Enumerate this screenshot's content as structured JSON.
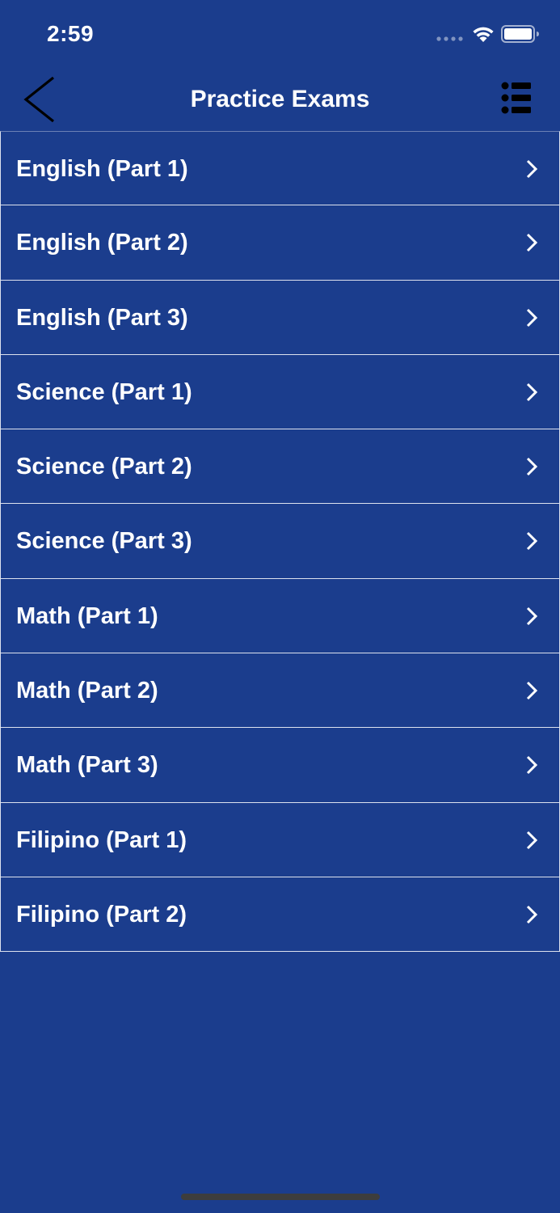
{
  "status_bar": {
    "time": "2:59"
  },
  "nav": {
    "title": "Practice Exams",
    "back_icon": "chevron-left-icon",
    "menu_icon": "list-menu-icon"
  },
  "exams": [
    {
      "label": "English (Part 1)"
    },
    {
      "label": "English (Part 2)"
    },
    {
      "label": "English (Part 3)"
    },
    {
      "label": "Science (Part 1)"
    },
    {
      "label": "Science (Part 2)"
    },
    {
      "label": "Science (Part 3)"
    },
    {
      "label": "Math (Part 1)"
    },
    {
      "label": "Math (Part 2)"
    },
    {
      "label": "Math (Part 3)"
    },
    {
      "label": "Filipino (Part 1)"
    },
    {
      "label": "Filipino (Part 2)"
    }
  ],
  "colors": {
    "background": "#1b3d8d",
    "text": "#ffffff",
    "divider": "#ffffff"
  }
}
